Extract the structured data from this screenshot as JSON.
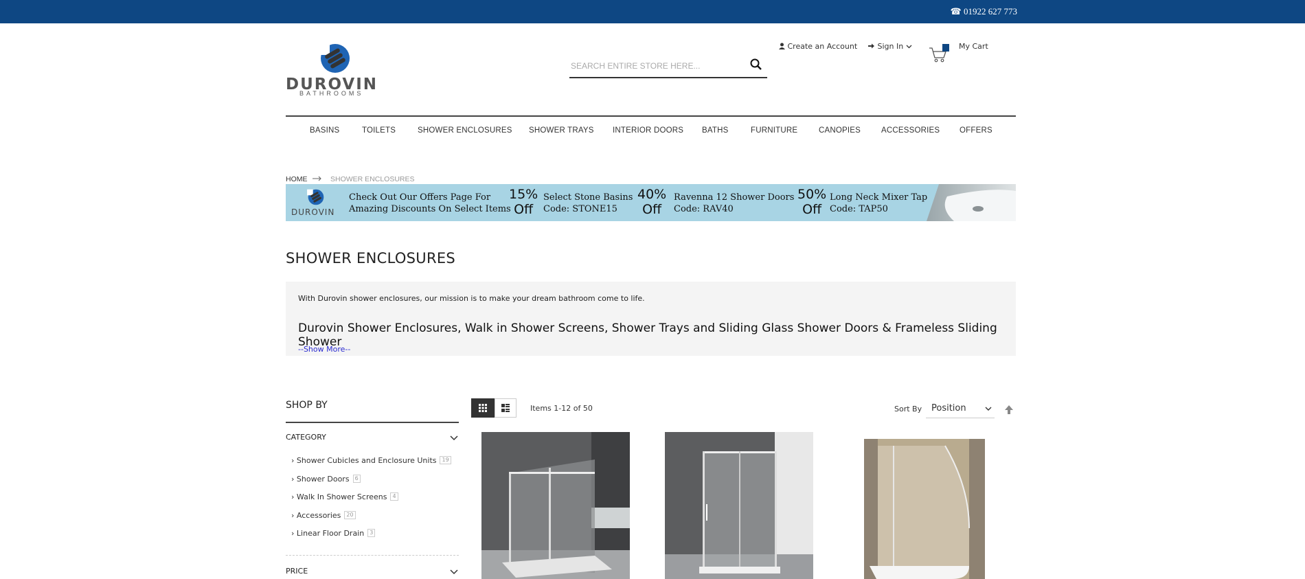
{
  "topbar": {
    "phone": "☎ 01922 627 773"
  },
  "logo": {
    "brand": "DUROVIN",
    "sub": "BATHROOMS"
  },
  "search": {
    "placeholder": "SEARCH ENTIRE STORE HERE..."
  },
  "header": {
    "create_account": "Create an Account",
    "sign_in": "Sign In",
    "cart": "My Cart"
  },
  "nav": [
    "BASINS",
    "TOILETS",
    "SHOWER ENCLOSURES",
    "SHOWER TRAYS",
    "INTERIOR DOORS",
    "BATHS",
    "FURNITURE",
    "CANOPIES",
    "ACCESSORIES",
    "OFFERS"
  ],
  "breadcrumb": {
    "home": "HOME",
    "current": "SHOWER ENCLOSURES"
  },
  "banner": {
    "logo": "DUROVIN",
    "message_line1": "Check Out Our Offers Page For",
    "message_line2": "Amazing Discounts On Select Items",
    "offers": [
      {
        "pct": "15%",
        "off": "Off",
        "item": "Select Stone Basins",
        "code": "Code: STONE15"
      },
      {
        "pct": "40%",
        "off": "Off",
        "item": "Ravenna 12 Shower Doors",
        "code": "Code: RAV40"
      },
      {
        "pct": "50%",
        "off": "Off",
        "item": "Long Neck Mixer Tap",
        "code": "Code: TAP50"
      }
    ]
  },
  "page_title": "SHOWER ENCLOSURES",
  "description": {
    "intro": "With Durovin shower enclosures, our mission is to make your dream bathroom come to life.",
    "heading": "Durovin Shower Enclosures, Walk in Shower Screens, Shower Trays and Sliding Glass Shower Doors & Frameless Sliding Shower",
    "show_more": "--Show More--"
  },
  "sidebar": {
    "shop_by": "SHOP BY",
    "category_title": "CATEGORY",
    "categories": [
      {
        "label": "Shower Cubicles and Enclosure Units",
        "count": "19"
      },
      {
        "label": "Shower Doors",
        "count": "6"
      },
      {
        "label": "Walk In Shower Screens",
        "count": "4"
      },
      {
        "label": "Accessories",
        "count": "20"
      },
      {
        "label": "Linear Floor Drain",
        "count": "3"
      }
    ],
    "price_title": "PRICE"
  },
  "toolbar": {
    "items": "Items 1-12 of 50",
    "sort_by": "Sort By",
    "sort_value": "Position"
  },
  "colors": {
    "topbar": "#0e4783",
    "banner": "#a8d4e4",
    "logo_blue": "#1f64b4"
  }
}
